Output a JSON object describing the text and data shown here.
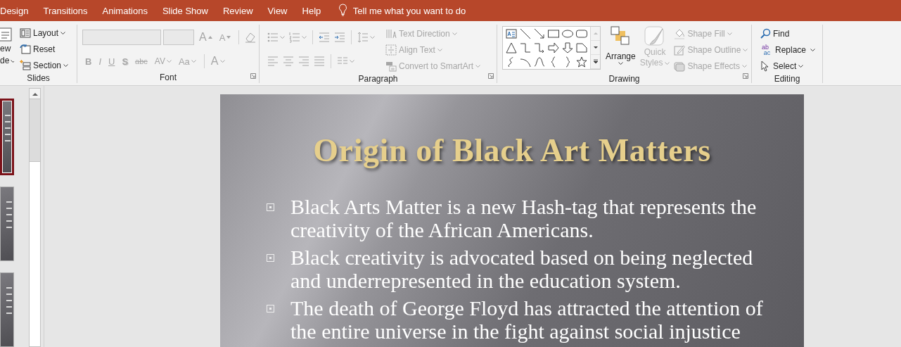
{
  "ribbon_tabs": [
    {
      "label": "Design",
      "selected": false
    },
    {
      "label": "Transitions",
      "selected": false
    },
    {
      "label": "Animations",
      "selected": false
    },
    {
      "label": "Slide Show",
      "selected": false
    },
    {
      "label": "Review",
      "selected": false
    },
    {
      "label": "View",
      "selected": false
    },
    {
      "label": "Help",
      "selected": false
    }
  ],
  "tell_me": {
    "placeholder": "Tell me what you want to do"
  },
  "ribbon_groups": [
    {
      "kind": "slides",
      "label": "Slides",
      "new_slide": {
        "label_lines": [
          "ew",
          "de"
        ],
        "dropdown": true
      },
      "commands": [
        {
          "label": "Layout",
          "dropdown": true,
          "disabled": false
        },
        {
          "label": "Reset",
          "dropdown": false,
          "disabled": false
        },
        {
          "label": "Section",
          "dropdown": true,
          "disabled": false
        }
      ]
    },
    {
      "kind": "font",
      "label": "Font",
      "disabled": true,
      "size_buttons": [
        "A",
        "A"
      ],
      "format_buttons": [
        {
          "label": "B",
          "dropdown": false
        },
        {
          "label": "I",
          "dropdown": false
        },
        {
          "label": "U",
          "dropdown": false
        },
        {
          "label": "S",
          "dropdown": false
        },
        {
          "label": "abc",
          "dropdown": false
        },
        {
          "label": "AV",
          "dropdown": true
        },
        {
          "label": "Aa",
          "dropdown": true
        },
        {
          "label": "A",
          "dropdown": true
        }
      ]
    },
    {
      "kind": "paragraph",
      "label": "Paragraph",
      "disabled": true,
      "commands": [
        {
          "label": "Text Direction",
          "dropdown": true
        },
        {
          "label": "Align Text",
          "dropdown": true
        },
        {
          "label": "Convert to SmartArt",
          "dropdown": true
        }
      ]
    },
    {
      "kind": "drawing",
      "label": "Drawing",
      "arrange": {
        "label": "Arrange",
        "disabled": false
      },
      "quick_styles": {
        "label_lines": [
          "Quick",
          "Styles"
        ],
        "disabled": true
      },
      "commands": [
        {
          "label": "Shape Fill",
          "dropdown": true,
          "disabled": true
        },
        {
          "label": "Shape Outline",
          "dropdown": true,
          "disabled": true
        },
        {
          "label": "Shape Effects",
          "dropdown": true,
          "disabled": true
        }
      ]
    },
    {
      "kind": "editing",
      "label": "Editing",
      "replace_icon_letters": [
        "ab",
        "ac"
      ],
      "commands": [
        {
          "label": "Find",
          "dropdown": false,
          "disabled": false
        },
        {
          "label": "Replace",
          "dropdown": true,
          "disabled": false
        },
        {
          "label": "Select",
          "dropdown": true,
          "disabled": false
        }
      ]
    }
  ],
  "thumbnails": [
    {
      "selected": true
    },
    {
      "selected": false
    },
    {
      "selected": false
    }
  ],
  "slide": {
    "title": "Origin of Black Art Matters",
    "bullets": [
      "Black Arts Matter is a new Hash-tag that represents the creativity of the African Americans.",
      "Black creativity is advocated based on being neglected and underrepresented in the education system.",
      "The death of George Floyd has attracted the attention of the entire universe in the fight against social injustice"
    ]
  }
}
